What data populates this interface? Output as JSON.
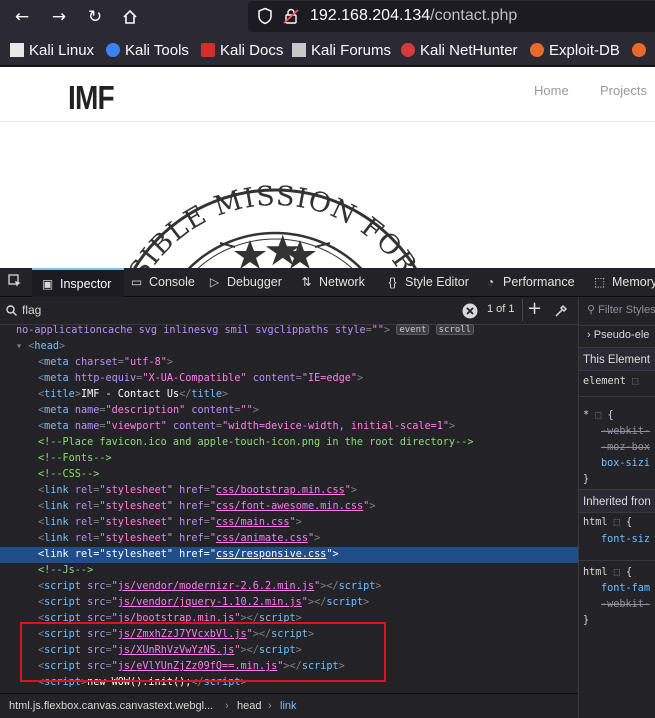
{
  "browser": {
    "url_host": "192.168.204.134",
    "url_path": "/contact.php",
    "bookmarks": [
      "Kali Linux",
      "Kali Tools",
      "Kali Docs",
      "Kali Forums",
      "Kali NetHunter",
      "Exploit-DB"
    ]
  },
  "site": {
    "logo": "IMF",
    "nav_home": "Home",
    "nav_projects": "Projects",
    "seal_text": "POSSIBLE MISSION FOR"
  },
  "devtools": {
    "tabs": [
      "Inspector",
      "Console",
      "Debugger",
      "Network",
      "Style Editor",
      "Performance",
      "Memory"
    ],
    "search_value": "flag",
    "matches": "1 of 1",
    "markup": {
      "l0_attrs": "no-applicationcache svg inlinesvg smil svgclippaths",
      "l0_style_attr": "style",
      "l0_style_val": "\"\"",
      "badge_event": "event",
      "badge_scroll": "scroll",
      "head": "head",
      "charset": "\"utf-8\"",
      "compat": "\"X-UA-Compatible\"",
      "compat_content": "\"IE=edge\"",
      "title": "IMF - Contact Us",
      "desc_name": "\"description\"",
      "desc_content": "\"\"",
      "viewport_name": "\"viewport\"",
      "viewport_content": "\"width=device-width, initial-scale=1\"",
      "comment_favicon": "<!--Place favicon.ico and apple-touch-icon.png in the root directory-->",
      "comment_fonts": "<!--Fonts-->",
      "comment_css": "<!--CSS-->",
      "comment_js": "<!--Js-->",
      "css_dir": "css/",
      "css_files": [
        "bootstrap.min.css",
        "font-awesome.min.css",
        "main.css",
        "animate.css",
        "responsive.css"
      ],
      "js_dir": "js/",
      "js_files": [
        "vendor/modernizr-2.6.2.min.js",
        "vendor/jquery-1.10.2.min.js",
        "bootstrap.min.js",
        "ZmxhZzJ7YVcxbVl.js",
        "XUnRhVzVwYzNS.js",
        "eVlYUnZjZz09fQ==.min.js"
      ],
      "inline_script": "new WOW().init();"
    },
    "breadcrumbs": [
      "html.js.flexbox.canvas.canvastext.webgl...",
      "head",
      "link"
    ],
    "rules": {
      "filter_placeholder": "Filter Styles",
      "pseudo": "Pseudo-ele",
      "this_element": "This Element",
      "element_sel": "element",
      "universal_sel": "*",
      "webkit": "-webkit-",
      "moz": "-moz-box",
      "box_sizing": "box-sizi",
      "inherited": "Inherited fron",
      "html_sel": "html",
      "font_size": "font-siz",
      "font_family": "font-fam",
      "webkit2": "-webkit-"
    }
  }
}
